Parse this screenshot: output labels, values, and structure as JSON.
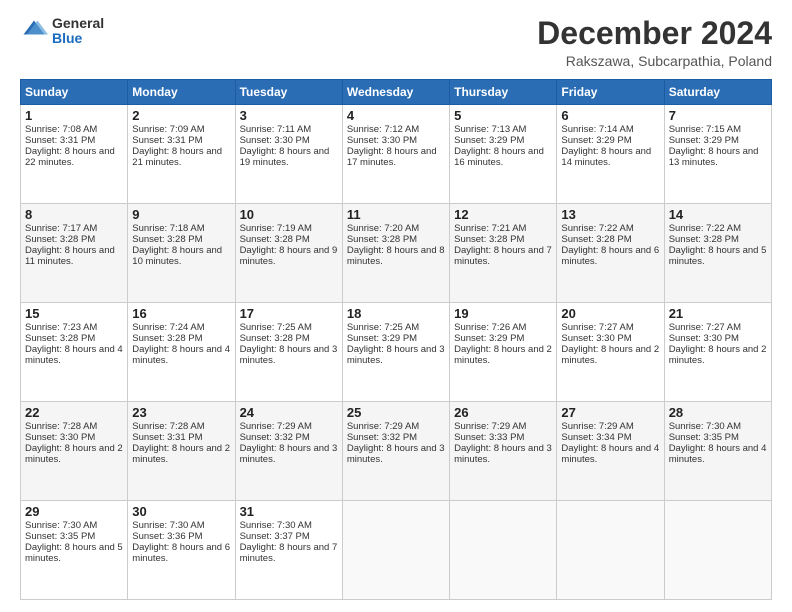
{
  "logo": {
    "general": "General",
    "blue": "Blue"
  },
  "header": {
    "title": "December 2024",
    "subtitle": "Rakszawa, Subcarpathia, Poland"
  },
  "weekdays": [
    "Sunday",
    "Monday",
    "Tuesday",
    "Wednesday",
    "Thursday",
    "Friday",
    "Saturday"
  ],
  "weeks": [
    [
      {
        "day": "1",
        "rise": "7:08 AM",
        "set": "3:31 PM",
        "daylight": "8 hours and 22 minutes."
      },
      {
        "day": "2",
        "rise": "7:09 AM",
        "set": "3:31 PM",
        "daylight": "8 hours and 21 minutes."
      },
      {
        "day": "3",
        "rise": "7:11 AM",
        "set": "3:30 PM",
        "daylight": "8 hours and 19 minutes."
      },
      {
        "day": "4",
        "rise": "7:12 AM",
        "set": "3:30 PM",
        "daylight": "8 hours and 17 minutes."
      },
      {
        "day": "5",
        "rise": "7:13 AM",
        "set": "3:29 PM",
        "daylight": "8 hours and 16 minutes."
      },
      {
        "day": "6",
        "rise": "7:14 AM",
        "set": "3:29 PM",
        "daylight": "8 hours and 14 minutes."
      },
      {
        "day": "7",
        "rise": "7:15 AM",
        "set": "3:29 PM",
        "daylight": "8 hours and 13 minutes."
      }
    ],
    [
      {
        "day": "8",
        "rise": "7:17 AM",
        "set": "3:28 PM",
        "daylight": "8 hours and 11 minutes."
      },
      {
        "day": "9",
        "rise": "7:18 AM",
        "set": "3:28 PM",
        "daylight": "8 hours and 10 minutes."
      },
      {
        "day": "10",
        "rise": "7:19 AM",
        "set": "3:28 PM",
        "daylight": "8 hours and 9 minutes."
      },
      {
        "day": "11",
        "rise": "7:20 AM",
        "set": "3:28 PM",
        "daylight": "8 hours and 8 minutes."
      },
      {
        "day": "12",
        "rise": "7:21 AM",
        "set": "3:28 PM",
        "daylight": "8 hours and 7 minutes."
      },
      {
        "day": "13",
        "rise": "7:22 AM",
        "set": "3:28 PM",
        "daylight": "8 hours and 6 minutes."
      },
      {
        "day": "14",
        "rise": "7:22 AM",
        "set": "3:28 PM",
        "daylight": "8 hours and 5 minutes."
      }
    ],
    [
      {
        "day": "15",
        "rise": "7:23 AM",
        "set": "3:28 PM",
        "daylight": "8 hours and 4 minutes."
      },
      {
        "day": "16",
        "rise": "7:24 AM",
        "set": "3:28 PM",
        "daylight": "8 hours and 4 minutes."
      },
      {
        "day": "17",
        "rise": "7:25 AM",
        "set": "3:28 PM",
        "daylight": "8 hours and 3 minutes."
      },
      {
        "day": "18",
        "rise": "7:25 AM",
        "set": "3:29 PM",
        "daylight": "8 hours and 3 minutes."
      },
      {
        "day": "19",
        "rise": "7:26 AM",
        "set": "3:29 PM",
        "daylight": "8 hours and 2 minutes."
      },
      {
        "day": "20",
        "rise": "7:27 AM",
        "set": "3:30 PM",
        "daylight": "8 hours and 2 minutes."
      },
      {
        "day": "21",
        "rise": "7:27 AM",
        "set": "3:30 PM",
        "daylight": "8 hours and 2 minutes."
      }
    ],
    [
      {
        "day": "22",
        "rise": "7:28 AM",
        "set": "3:30 PM",
        "daylight": "8 hours and 2 minutes."
      },
      {
        "day": "23",
        "rise": "7:28 AM",
        "set": "3:31 PM",
        "daylight": "8 hours and 2 minutes."
      },
      {
        "day": "24",
        "rise": "7:29 AM",
        "set": "3:32 PM",
        "daylight": "8 hours and 3 minutes."
      },
      {
        "day": "25",
        "rise": "7:29 AM",
        "set": "3:32 PM",
        "daylight": "8 hours and 3 minutes."
      },
      {
        "day": "26",
        "rise": "7:29 AM",
        "set": "3:33 PM",
        "daylight": "8 hours and 3 minutes."
      },
      {
        "day": "27",
        "rise": "7:29 AM",
        "set": "3:34 PM",
        "daylight": "8 hours and 4 minutes."
      },
      {
        "day": "28",
        "rise": "7:30 AM",
        "set": "3:35 PM",
        "daylight": "8 hours and 4 minutes."
      }
    ],
    [
      {
        "day": "29",
        "rise": "7:30 AM",
        "set": "3:35 PM",
        "daylight": "8 hours and 5 minutes."
      },
      {
        "day": "30",
        "rise": "7:30 AM",
        "set": "3:36 PM",
        "daylight": "8 hours and 6 minutes."
      },
      {
        "day": "31",
        "rise": "7:30 AM",
        "set": "3:37 PM",
        "daylight": "8 hours and 7 minutes."
      },
      null,
      null,
      null,
      null
    ]
  ]
}
